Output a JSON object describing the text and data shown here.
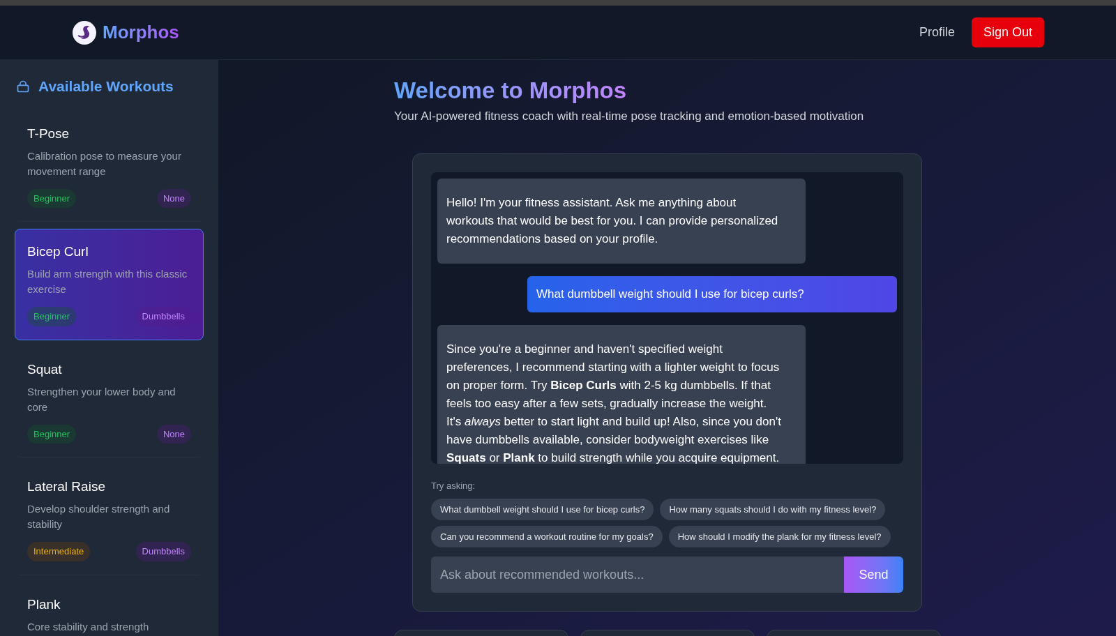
{
  "header": {
    "brand": "Morphos",
    "nav": [
      {
        "label": "Profile",
        "kind": "link"
      },
      {
        "label": "Sign Out",
        "kind": "danger"
      }
    ]
  },
  "sidebar": {
    "title": "Available Workouts",
    "workouts": [
      {
        "name": "T-Pose",
        "description": "Calibration pose to measure your movement range",
        "selected": false,
        "difficulty": {
          "label": "Beginner",
          "kind": "beginner"
        },
        "equipment": "None"
      },
      {
        "name": "Bicep Curl",
        "description": "Build arm strength with this classic exercise",
        "selected": true,
        "difficulty": {
          "label": "Beginner",
          "kind": "beginner"
        },
        "equipment": "Dumbbells"
      },
      {
        "name": "Squat",
        "description": "Strengthen your lower body and core",
        "selected": false,
        "difficulty": {
          "label": "Beginner",
          "kind": "beginner"
        },
        "equipment": "None"
      },
      {
        "name": "Lateral Raise",
        "description": "Develop shoulder strength and stability",
        "selected": false,
        "difficulty": {
          "label": "Intermediate",
          "kind": "intermediate"
        },
        "equipment": "Dumbbells"
      },
      {
        "name": "Plank",
        "description": "Core stability and strength",
        "selected": false
      }
    ]
  },
  "main": {
    "title": "Welcome to Morphos",
    "subtitle": "Your AI-powered fitness coach with real-time pose tracking and emotion-based motivation",
    "chat": {
      "messages": [
        {
          "kind": "assistant",
          "text": "Hello! I'm your fitness assistant. Ask me anything about workouts that would be best for you. I can provide personalized recommendations based on your profile."
        },
        {
          "kind": "user",
          "text": "What dumbbell weight should I use for bicep curls?"
        },
        {
          "kind": "assistant",
          "text": "Since you're a beginner and haven't specified weight preferences, I recommend starting with a lighter weight to focus on proper form. Try **Bicep Curls** with 2-5 kg dumbbells. If that feels too easy after a few sets, gradually increase the weight. It's *always* better to start light and build up! Also, since you don't have dumbbells available, consider bodyweight exercises like **Squats** or **Plank** to build strength while you acquire equipment."
        }
      ],
      "suggestions_label": "Try asking:",
      "suggestions": [
        "What dumbbell weight should I use for bicep curls?",
        "How many squats should I do with my fitness level?",
        "Can you recommend a workout routine for my goals?",
        "How should I modify the plank for my fitness level?"
      ],
      "input": {
        "placeholder": "Ask about recommended workouts..."
      },
      "send": "Send"
    }
  }
}
